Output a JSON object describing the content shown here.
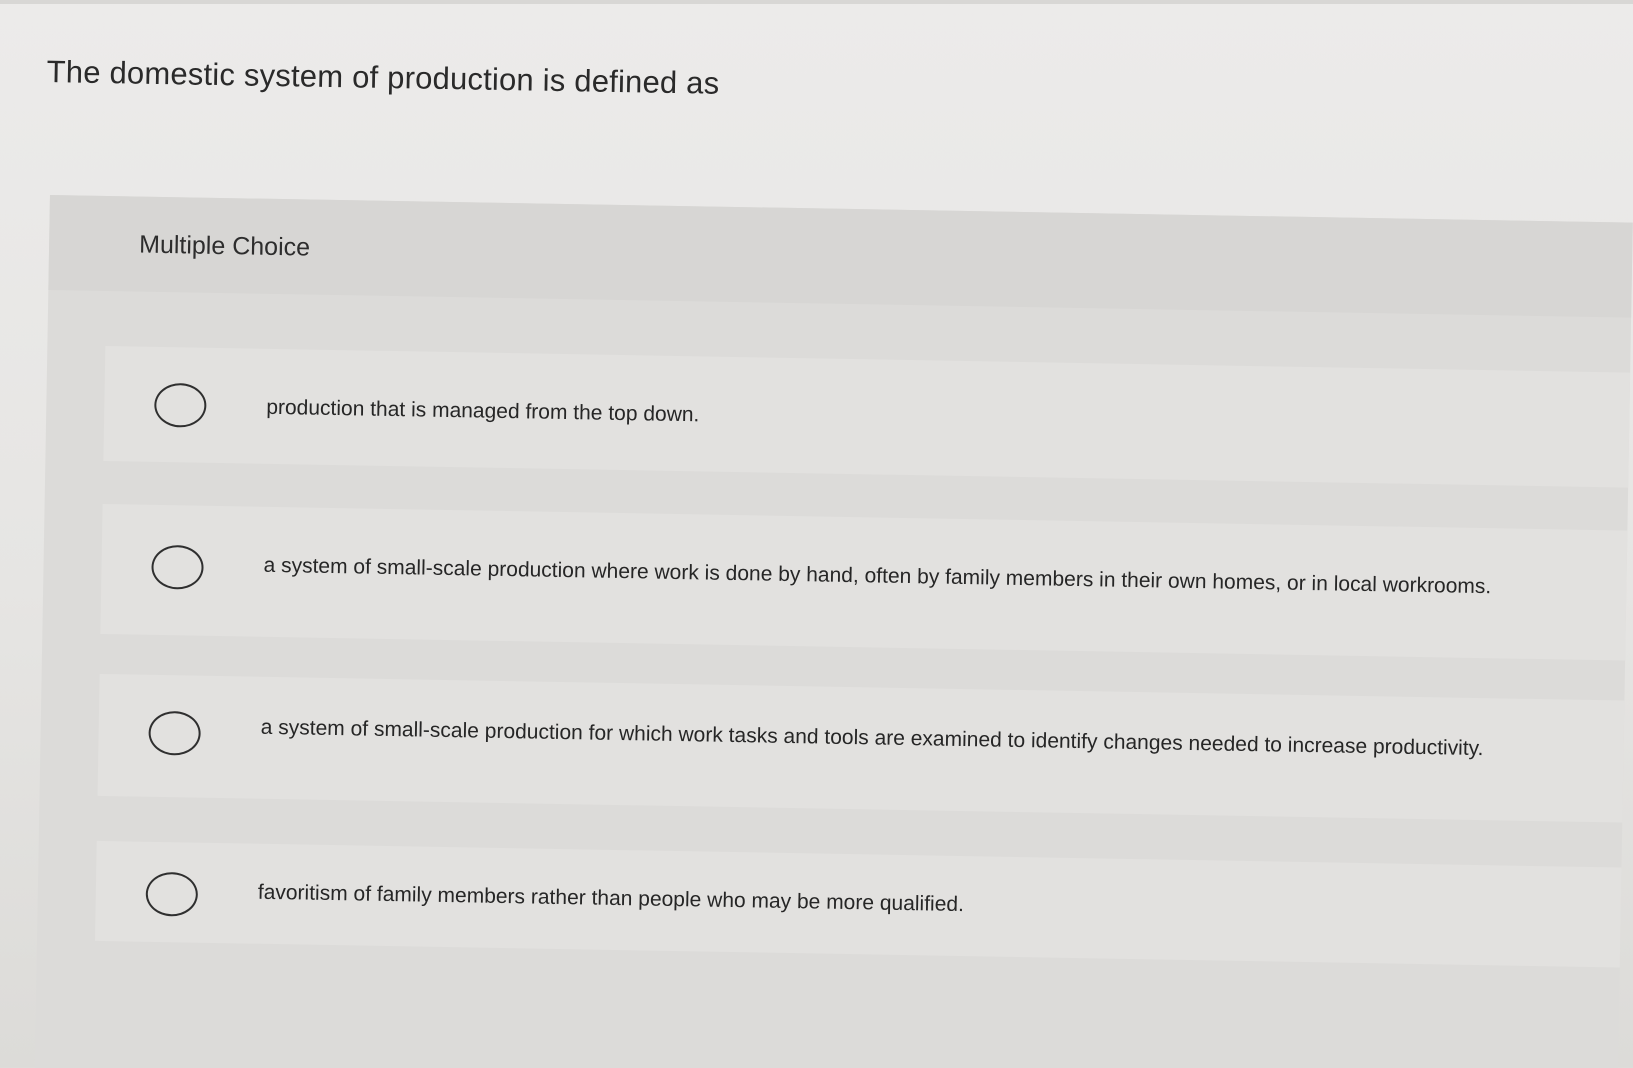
{
  "question": {
    "text": "The domestic system of production is defined as"
  },
  "panel": {
    "type_label": "Multiple Choice"
  },
  "options": [
    {
      "text": "production that is managed from the top down.",
      "selected": false
    },
    {
      "text": "a system of small-scale production where work is done by hand, often by family members in their own homes, or in local workrooms.",
      "selected": false
    },
    {
      "text": "a system of small-scale production for which work tasks and tools are examined to identify changes needed to increase productivity.",
      "selected": false
    },
    {
      "text": "favoritism of family members rather than people who may be more qualified.",
      "selected": false
    }
  ],
  "colors": {
    "background": "#e8e7e5",
    "panel": "#dcdbd9",
    "option_card": "#e2e1df",
    "text": "#2b2b2b"
  }
}
